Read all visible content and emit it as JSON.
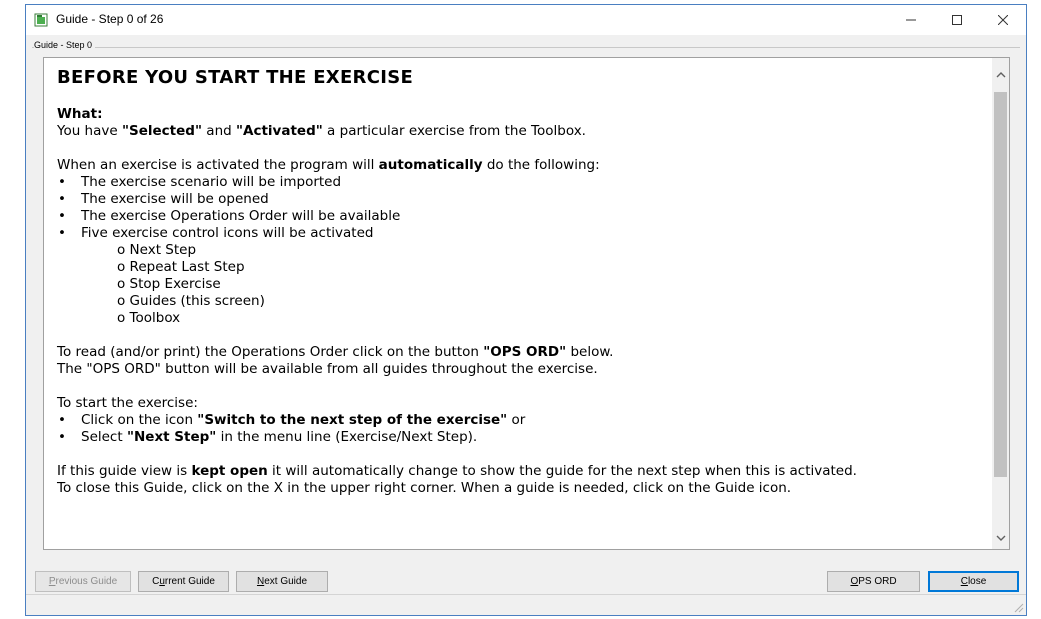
{
  "window": {
    "title": "Guide - Step 0 of 26"
  },
  "group_label": "Guide - Step 0",
  "doc": {
    "heading": "BEFORE YOU START THE EXERCISE",
    "what_label": "What:",
    "what_line": {
      "a": "You have ",
      "b": "\"Selected\"",
      "c": " and ",
      "d": "\"Activated\"",
      "e": " a particular exercise from the Toolbox."
    },
    "auto_line": {
      "a": "When an exercise is activated the program will ",
      "b": "automatically",
      "c": " do the following:"
    },
    "bullets": [
      "The exercise scenario will be imported",
      "The exercise will be opened",
      "The exercise Operations Order will be available",
      "Five exercise control icons will be activated"
    ],
    "sub_items": [
      "o Next Step",
      "o Repeat Last Step",
      "o Stop Exercise",
      "o Guides (this screen)",
      "o Toolbox"
    ],
    "opsord_line1": {
      "a": "To read (and/or print) the Operations Order click on the button ",
      "b": "\"OPS ORD\"",
      "c": " below."
    },
    "opsord_line2": "The \"OPS ORD\" button will be available from all guides throughout the exercise.",
    "start_label": "To start the exercise:",
    "start_bullet1": {
      "a": "Click on the icon ",
      "b": "\"Switch to the next step of the exercise\"",
      "c": " or"
    },
    "start_bullet2": {
      "a": "Select ",
      "b": "\"Next Step\"",
      "c": " in the menu line (Exercise/Next Step)."
    },
    "open_line": {
      "a": "If this guide view is ",
      "b": "kept open",
      "c": " it will automatically change to show the guide for the next step when this is activated."
    },
    "close_line": "To close this Guide, click on the X in the upper right corner. When a guide is needed, click on the Guide icon."
  },
  "buttons": {
    "previous": {
      "u": "P",
      "rest": "revious Guide"
    },
    "current": {
      "pre": "C",
      "u": "u",
      "rest": "rrent Guide"
    },
    "next": {
      "u": "N",
      "rest": "ext Guide"
    },
    "opsord": {
      "u": "O",
      "rest": "PS ORD"
    },
    "close": {
      "u": "C",
      "rest": "lose"
    }
  },
  "icons": {
    "app": "guide-app-icon",
    "minimize": "minimize-icon",
    "maximize": "maximize-icon",
    "close": "close-icon",
    "scroll_up": "chevron-up-icon",
    "scroll_down": "chevron-down-icon"
  }
}
